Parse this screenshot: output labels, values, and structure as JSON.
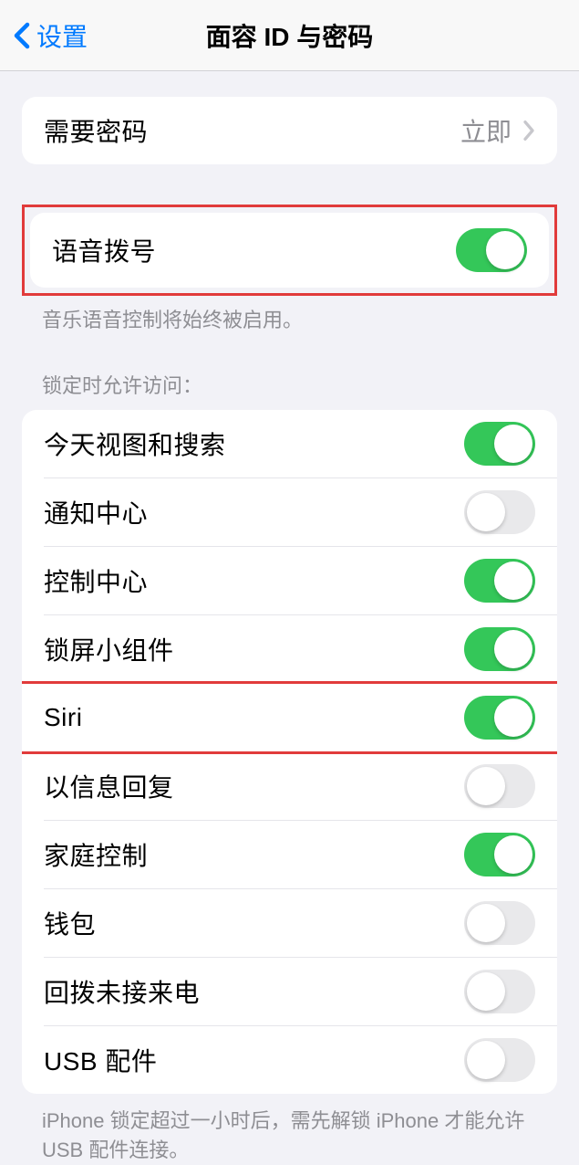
{
  "nav": {
    "back_label": "设置",
    "title": "面容 ID 与密码"
  },
  "require_passcode": {
    "label": "需要密码",
    "value": "立即"
  },
  "voice_dial": {
    "label": "语音拨号",
    "footer": "音乐语音控制将始终被启用。"
  },
  "allow_access_header": "锁定时允许访问：",
  "allow_access": {
    "today": "今天视图和搜索",
    "notif": "通知中心",
    "control": "控制中心",
    "widgets": "锁屏小组件",
    "siri": "Siri",
    "reply": "以信息回复",
    "home": "家庭控制",
    "wallet": "钱包",
    "callback": "回拨未接来电",
    "usb": "USB 配件"
  },
  "usb_footer": "iPhone 锁定超过一小时后，需先解锁 iPhone 才能允许 USB 配件连接。"
}
